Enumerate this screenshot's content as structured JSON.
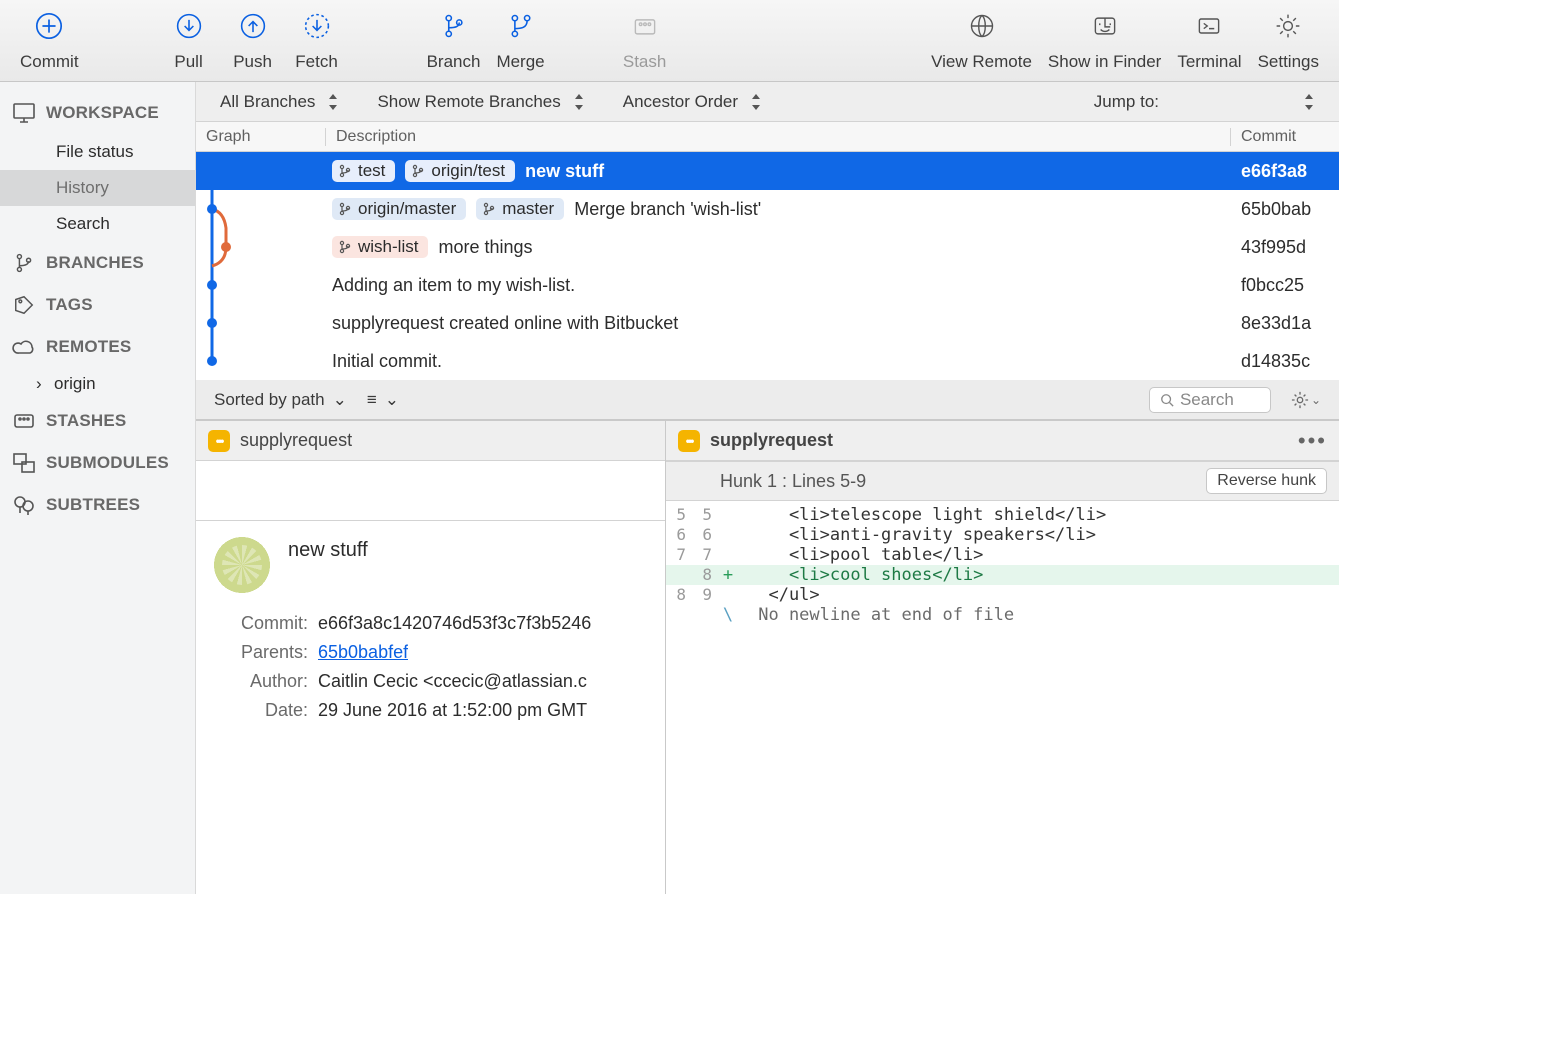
{
  "toolbar": {
    "commit": "Commit",
    "pull": "Pull",
    "push": "Push",
    "fetch": "Fetch",
    "branch": "Branch",
    "merge": "Merge",
    "stash": "Stash",
    "view_remote": "View Remote",
    "show_in_finder": "Show in Finder",
    "terminal": "Terminal",
    "settings": "Settings"
  },
  "sidebar": {
    "workspace": {
      "label": "WORKSPACE",
      "items": [
        "File status",
        "History",
        "Search"
      ],
      "selected_index": 1
    },
    "branches": {
      "label": "BRANCHES"
    },
    "tags": {
      "label": "TAGS"
    },
    "remotes": {
      "label": "REMOTES",
      "items": [
        "origin"
      ]
    },
    "stashes": {
      "label": "STASHES"
    },
    "submodules": {
      "label": "SUBMODULES"
    },
    "subtrees": {
      "label": "SUBTREES"
    }
  },
  "filterbar": {
    "branches": "All Branches",
    "remote": "Show Remote Branches",
    "order": "Ancestor Order",
    "jump": "Jump to:"
  },
  "history": {
    "columns": {
      "graph": "Graph",
      "description": "Description",
      "commit": "Commit"
    },
    "rows": [
      {
        "tags": [
          "test",
          "origin/test"
        ],
        "tag_style": "sel",
        "message": "new stuff",
        "hash": "e66f3a8",
        "selected": true
      },
      {
        "tags": [
          "origin/master",
          "master"
        ],
        "tag_style": "",
        "message": "Merge branch 'wish-list'",
        "hash": "65b0bab"
      },
      {
        "tags": [
          "wish-list"
        ],
        "tag_style": "red",
        "message": "more things",
        "hash": "43f995d"
      },
      {
        "tags": [],
        "message": "Adding an item to my wish-list.",
        "hash": "f0bcc25"
      },
      {
        "tags": [],
        "message": "supplyrequest created online with Bitbucket",
        "hash": "8e33d1a"
      },
      {
        "tags": [],
        "message": "Initial commit.",
        "hash": "d14835c"
      }
    ]
  },
  "lower_toolbar": {
    "sort": "Sorted by path",
    "search_placeholder": "Search"
  },
  "file": {
    "name": "supplyrequest"
  },
  "commit_detail": {
    "title": "new stuff",
    "rows": {
      "commit_k": "Commit:",
      "commit_v": "e66f3a8c1420746d53f3c7f3b5246",
      "parents_k": "Parents:",
      "parents_v": "65b0babfef",
      "author_k": "Author:",
      "author_v": "Caitlin Cecic <ccecic@atlassian.c",
      "date_k": "Date:",
      "date_v": "29 June 2016 at 1:52:00 pm GMT"
    }
  },
  "diff": {
    "hunk_label": "Hunk 1 : Lines 5-9",
    "reverse": "Reverse hunk",
    "lines": [
      {
        "a": "5",
        "b": "5",
        "op": " ",
        "text": "    <li>telescope light shield</li>"
      },
      {
        "a": "6",
        "b": "6",
        "op": " ",
        "text": "    <li>anti-gravity speakers</li>"
      },
      {
        "a": "7",
        "b": "7",
        "op": " ",
        "text": "    <li>pool table</li>"
      },
      {
        "a": "",
        "b": "8",
        "op": "+",
        "text": "    <li>cool shoes</li>"
      },
      {
        "a": "8",
        "b": "9",
        "op": " ",
        "text": "  </ul>"
      },
      {
        "a": "",
        "b": "",
        "op": "\\",
        "text": " No newline at end of file"
      }
    ]
  }
}
